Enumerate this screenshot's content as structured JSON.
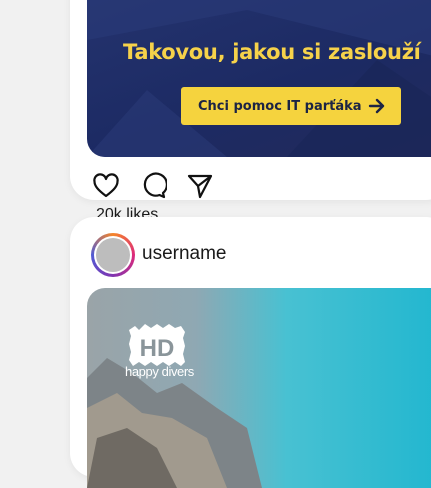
{
  "ad": {
    "headline": "Takovou, jakou si zaslouží",
    "cta_label": "Chci pomoc IT parťáka",
    "headline_color": "#f6d24a",
    "cta_color": "#f5d33e"
  },
  "post1": {
    "likes": "20k likes",
    "icons": [
      "heart-icon",
      "comment-icon",
      "share-icon"
    ]
  },
  "post2": {
    "username": "username",
    "logo_text": "HD",
    "logo_caption": "happy divers"
  }
}
